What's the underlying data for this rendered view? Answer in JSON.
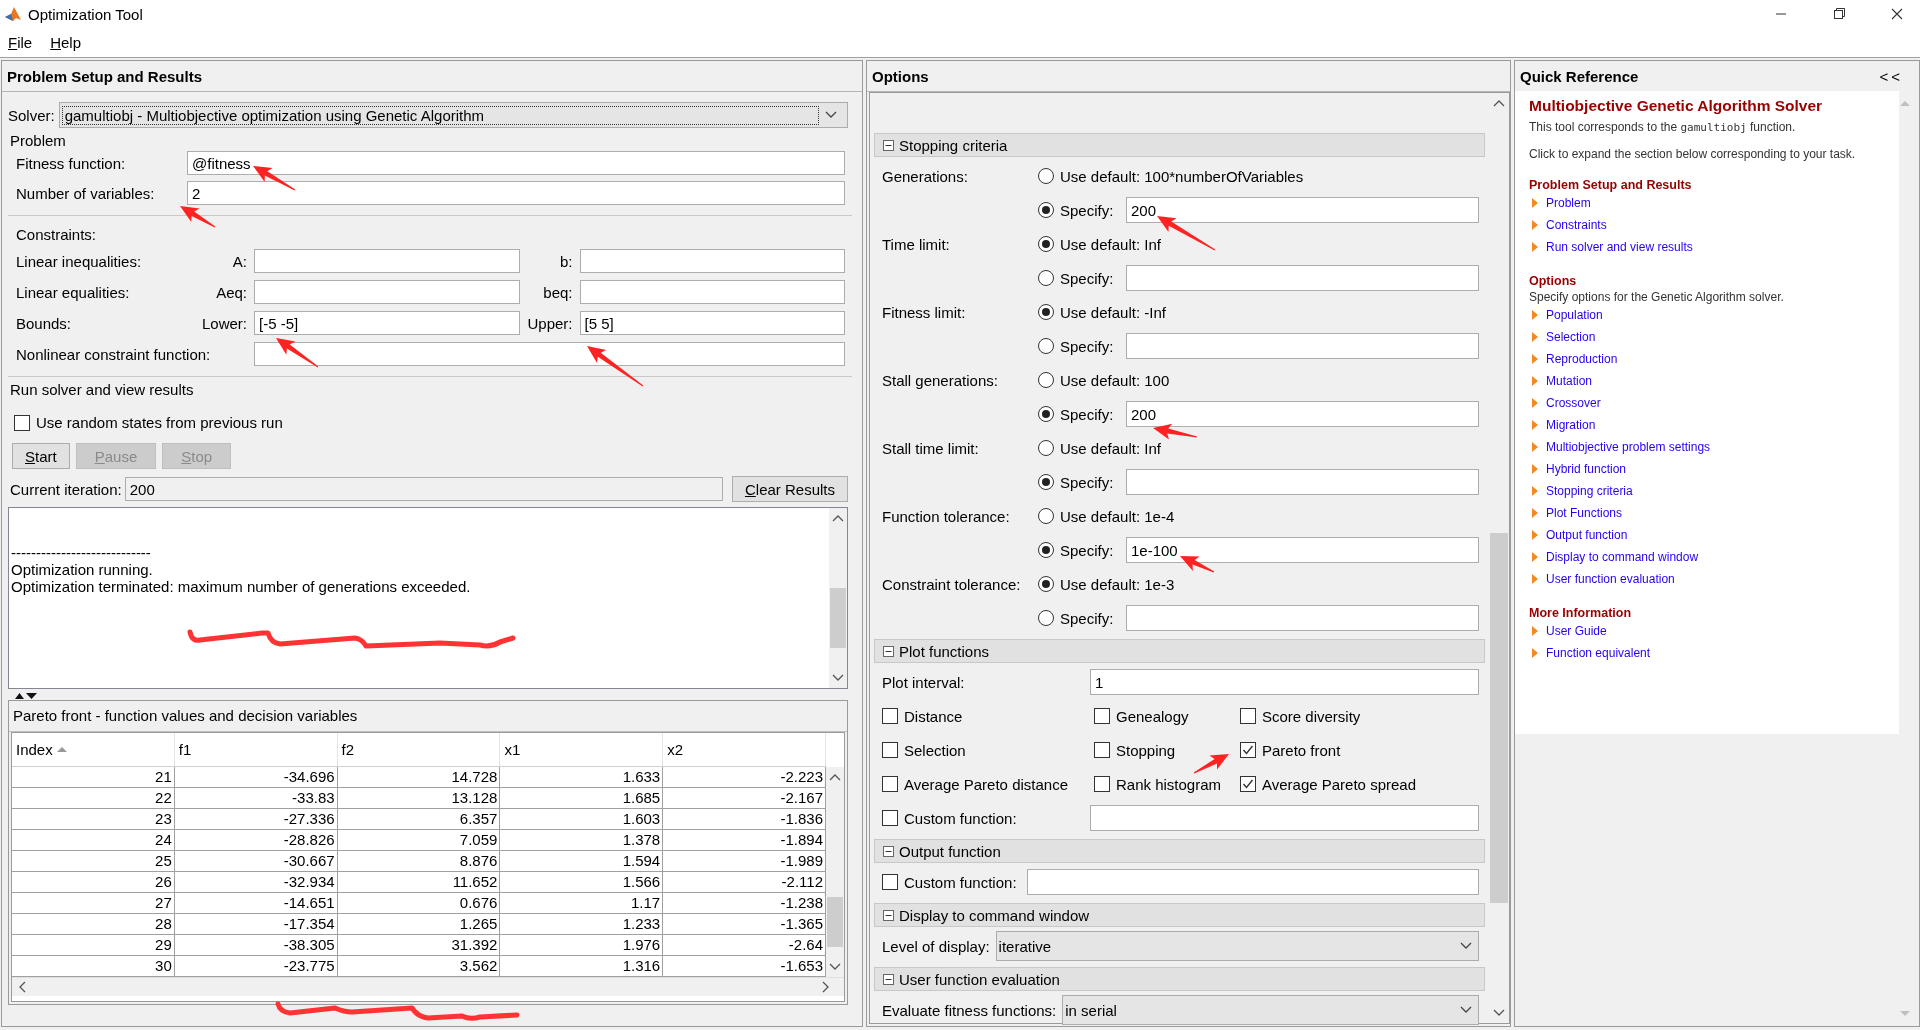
{
  "window": {
    "title": "Optimization Tool"
  },
  "menu": [
    "File",
    "Help"
  ],
  "problem_setup": {
    "title": "Problem Setup and Results",
    "solver": {
      "label": "Solver:",
      "value": "gamultiobj - Multiobjective optimization using Genetic Algorithm"
    },
    "problem": {
      "legend": "Problem",
      "fields": [
        {
          "label": "Fitness function:",
          "value": "@fitness"
        },
        {
          "label": "Number of variables:",
          "value": "2"
        }
      ]
    },
    "constraints": {
      "title": "Constraints:",
      "rows": [
        {
          "label": "Linear inequalities:",
          "fields": [
            {
              "label": "A:"
            },
            {
              "label": "b:"
            }
          ]
        },
        {
          "label": "Linear equalities:",
          "fields": [
            {
              "label": "Aeq:"
            },
            {
              "label": "beq:"
            }
          ]
        },
        {
          "label": "Bounds:",
          "fields": [
            {
              "label": "Lower:",
              "value": "[-5 -5]"
            },
            {
              "label": "Upper:",
              "value": "[5 5]"
            }
          ]
        }
      ],
      "nonlinear": {
        "label": "Nonlinear constraint function:"
      }
    },
    "run": {
      "legend": "Run solver and view results",
      "random_states": {
        "label": "Use random states from previous run",
        "checked": false
      },
      "buttons": [
        {
          "label": "Start",
          "disabled": false
        },
        {
          "label": "Pause",
          "disabled": true
        },
        {
          "label": "Stop",
          "disabled": true
        }
      ],
      "iteration": {
        "label": "Current iteration:",
        "value": "200"
      },
      "clear_button": "Clear Results",
      "log": [
        "----------------------------",
        "Optimization running.",
        "Optimization terminated: maximum number of generations exceeded."
      ]
    },
    "pareto": {
      "title": "Pareto front - function values and decision variables",
      "columns": [
        {
          "label": "Index",
          "sorted": true
        },
        {
          "label": "f1",
          "sorted": false
        },
        {
          "label": "f2",
          "sorted": false
        },
        {
          "label": "x1",
          "sorted": false
        },
        {
          "label": "x2",
          "sorted": false
        }
      ],
      "rows": [
        [
          "21",
          "-34.696",
          "14.728",
          "1.633",
          "-2.223"
        ],
        [
          "22",
          "-33.83",
          "13.128",
          "1.685",
          "-2.167"
        ],
        [
          "23",
          "-27.336",
          "6.357",
          "1.603",
          "-1.836"
        ],
        [
          "24",
          "-28.826",
          "7.059",
          "1.378",
          "-1.894"
        ],
        [
          "25",
          "-30.667",
          "8.876",
          "1.594",
          "-1.989"
        ],
        [
          "26",
          "-32.934",
          "11.652",
          "1.566",
          "-2.112"
        ],
        [
          "27",
          "-14.651",
          "0.676",
          "1.17",
          "-1.238"
        ],
        [
          "28",
          "-17.354",
          "1.265",
          "1.233",
          "-1.365"
        ],
        [
          "29",
          "-38.305",
          "31.392",
          "1.976",
          "-2.64"
        ],
        [
          "30",
          "-23.775",
          "3.562",
          "1.316",
          "-1.653"
        ]
      ]
    }
  },
  "options": {
    "title": "Options",
    "sections": [
      {
        "title": "Stopping criteria",
        "expanded": true,
        "rows": [
          {
            "kind": "radio_pair",
            "label": "Generations:",
            "default": {
              "label": "Use default: 100*numberOfVariables",
              "selected": false
            },
            "specify": {
              "label": "Specify:",
              "selected": true,
              "value": "200"
            }
          },
          {
            "kind": "radio_pair",
            "label": "Time limit:",
            "default": {
              "label": "Use default: Inf",
              "selected": true
            },
            "specify": {
              "label": "Specify:",
              "selected": false
            }
          },
          {
            "kind": "radio_pair",
            "label": "Fitness limit:",
            "default": {
              "label": "Use default: -Inf",
              "selected": true
            },
            "specify": {
              "label": "Specify:",
              "selected": false
            }
          },
          {
            "kind": "radio_pair",
            "label": "Stall generations:",
            "default": {
              "label": "Use default: 100",
              "selected": false
            },
            "specify": {
              "label": "Specify:",
              "selected": true,
              "value": "200"
            }
          },
          {
            "kind": "radio_pair",
            "label": "Stall time limit:",
            "default": {
              "label": "Use default: Inf",
              "selected": false
            },
            "specify": {
              "label": "Specify:",
              "selected": true
            }
          },
          {
            "kind": "radio_pair",
            "label": "Function tolerance:",
            "default": {
              "label": "Use default: 1e-4",
              "selected": false
            },
            "specify": {
              "label": "Specify:",
              "selected": true,
              "value": "1e-100"
            }
          },
          {
            "kind": "radio_pair",
            "label": "Constraint tolerance:",
            "default": {
              "label": "Use default: 1e-3",
              "selected": true
            },
            "specify": {
              "label": "Specify:",
              "selected": false
            }
          }
        ]
      },
      {
        "title": "Plot functions",
        "expanded": true,
        "rows": [
          {
            "kind": "field",
            "label": "Plot interval:",
            "value": "1"
          },
          {
            "kind": "checkboxes",
            "items": [
              {
                "label": "Distance",
                "checked": false
              },
              {
                "label": "Genealogy",
                "checked": false
              },
              {
                "label": "Score diversity",
                "checked": false
              }
            ]
          },
          {
            "kind": "checkboxes",
            "items": [
              {
                "label": "Selection",
                "checked": false
              },
              {
                "label": "Stopping",
                "checked": false
              },
              {
                "label": "Pareto front",
                "checked": true
              }
            ]
          },
          {
            "kind": "checkboxes",
            "items": [
              {
                "label": "Average Pareto distance",
                "checked": false
              },
              {
                "label": "Rank histogram",
                "checked": false
              },
              {
                "label": "Average Pareto spread",
                "checked": true
              }
            ]
          },
          {
            "kind": "check_field",
            "label": "Custom function:",
            "checked": false
          }
        ]
      },
      {
        "title": "Output function",
        "expanded": true,
        "rows": [
          {
            "kind": "check_field",
            "label": "Custom function:",
            "checked": false
          }
        ]
      },
      {
        "title": "Display to command window",
        "expanded": true,
        "rows": [
          {
            "kind": "select",
            "label": "Level of display:",
            "value": "iterative"
          }
        ]
      },
      {
        "title": "User function evaluation",
        "expanded": true,
        "rows": [
          {
            "kind": "select",
            "label": "Evaluate fitness functions:",
            "value": "in serial"
          }
        ]
      }
    ]
  },
  "quick_reference": {
    "title": "Quick Reference",
    "collapse": "<<",
    "heading": "Multiobjective Genetic Algorithm Solver",
    "intro": [
      {
        "text": "This tool corresponds to the "
      },
      {
        "text": "gamultiobj",
        "kind": "code"
      },
      {
        "text": " function."
      }
    ],
    "hint": "Click to expand the section below corresponding to your task.",
    "sections": [
      {
        "title": "Problem Setup and Results",
        "links": [
          "Problem",
          "Constraints",
          "Run solver and view results"
        ]
      },
      {
        "title": "Options",
        "description": "Specify options for the Genetic Algorithm solver.",
        "links": [
          "Population",
          "Selection",
          "Reproduction",
          "Mutation",
          "Crossover",
          "Migration",
          "Multiobjective problem settings",
          "Hybrid function",
          "Stopping criteria",
          "Plot Functions",
          "Output function",
          "Display to command window",
          "User function evaluation"
        ]
      },
      {
        "title": "More Information",
        "links": [
          "User Guide",
          "Function equivalent"
        ]
      }
    ]
  }
}
